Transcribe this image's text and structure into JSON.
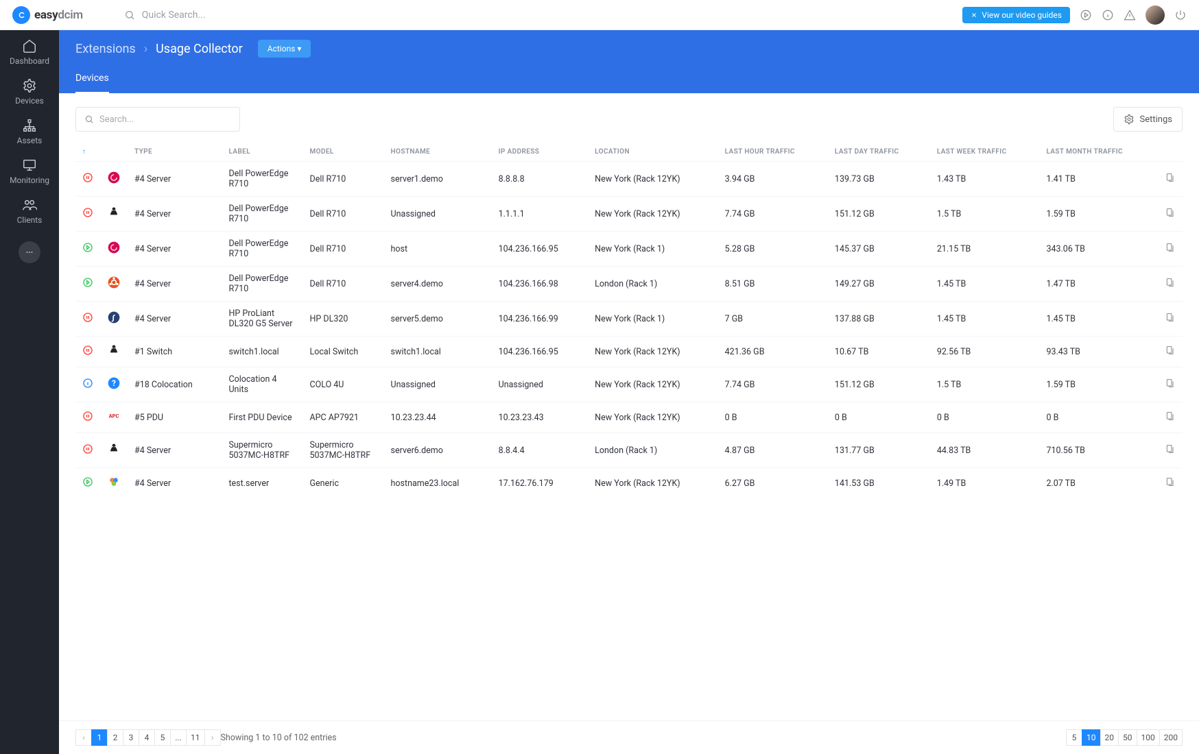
{
  "brand": {
    "name_bold": "easy",
    "name_gray": "dcim"
  },
  "search": {
    "placeholder": "Quick Search..."
  },
  "topbar": {
    "video_label": "View our video guides",
    "icons": [
      "play-circle",
      "info-circle",
      "alert-triangle",
      "power"
    ]
  },
  "sidebar": {
    "items": [
      {
        "label": "Dashboard",
        "icon": "home"
      },
      {
        "label": "Devices",
        "icon": "gear"
      },
      {
        "label": "Assets",
        "icon": "nodes"
      },
      {
        "label": "Monitoring",
        "icon": "monitor"
      },
      {
        "label": "Clients",
        "icon": "users"
      }
    ]
  },
  "breadcrumb": {
    "root": "Extensions",
    "leaf": "Usage Collector",
    "actions_label": "Actions"
  },
  "tabs": [
    {
      "label": "Devices",
      "active": true
    }
  ],
  "toolbar": {
    "search_placeholder": "Search...",
    "settings_label": "Settings"
  },
  "columns": [
    "",
    "",
    "TYPE",
    "LABEL",
    "MODEL",
    "HOSTNAME",
    "IP ADDRESS",
    "LOCATION",
    "LAST HOUR TRAFFIC",
    "LAST DAY TRAFFIC",
    "LAST WEEK TRAFFIC",
    "LAST MONTH TRAFFIC",
    ""
  ],
  "rows": [
    {
      "status": "stop",
      "os": "debian",
      "type": "#4 Server",
      "label": "Dell PowerEdge R710",
      "model": "Dell R710",
      "hostname": "server1.demo",
      "ip": "8.8.8.8",
      "location": "New York (Rack 12YK)",
      "hour": "3.94 GB",
      "day": "139.73 GB",
      "week": "1.43 TB",
      "month": "1.41 TB"
    },
    {
      "status": "stop",
      "os": "linux",
      "type": "#4 Server",
      "label": "Dell PowerEdge R710",
      "model": "Dell R710",
      "hostname": "Unassigned",
      "ip": "1.1.1.1",
      "location": "New York (Rack 12YK)",
      "hour": "7.74 GB",
      "day": "151.12 GB",
      "week": "1.5 TB",
      "month": "1.59 TB"
    },
    {
      "status": "run",
      "os": "debian",
      "type": "#4 Server",
      "label": "Dell PowerEdge R710",
      "model": "Dell R710",
      "hostname": "host",
      "ip": "104.236.166.95",
      "location": "New York (Rack 1)",
      "hour": "5.28 GB",
      "day": "145.37 GB",
      "week": "21.15 TB",
      "month": "343.06 TB"
    },
    {
      "status": "run",
      "os": "ubuntu",
      "type": "#4 Server",
      "label": "Dell PowerEdge R710",
      "model": "Dell R710",
      "hostname": "server4.demo",
      "ip": "104.236.166.98",
      "location": "London (Rack 1)",
      "hour": "8.51 GB",
      "day": "149.27 GB",
      "week": "1.45 TB",
      "month": "1.47 TB"
    },
    {
      "status": "stop",
      "os": "fedora",
      "type": "#4 Server",
      "label": "HP ProLiant DL320 G5 Server",
      "model": "HP DL320",
      "hostname": "server5.demo",
      "ip": "104.236.166.99",
      "location": "New York (Rack 1)",
      "hour": "7 GB",
      "day": "137.88 GB",
      "week": "1.45 TB",
      "month": "1.45 TB"
    },
    {
      "status": "stop",
      "os": "linux",
      "type": "#1 Switch",
      "label": "switch1.local",
      "model": "Local Switch",
      "hostname": "switch1.local",
      "ip": "104.236.166.95",
      "location": "New York (Rack 12YK)",
      "hour": "421.36 GB",
      "day": "10.67 TB",
      "week": "92.56 TB",
      "month": "93.43 TB"
    },
    {
      "status": "info",
      "os": "unknown",
      "type": "#18 Colocation",
      "label": "Colocation 4 Units",
      "model": "COLO 4U",
      "hostname": "Unassigned",
      "ip": "Unassigned",
      "location": "New York (Rack 12YK)",
      "hour": "7.74 GB",
      "day": "151.12 GB",
      "week": "1.5 TB",
      "month": "1.59 TB"
    },
    {
      "status": "stop",
      "os": "apc",
      "type": "#5 PDU",
      "label": "First PDU Device",
      "model": "APC AP7921",
      "hostname": "10.23.23.44",
      "ip": "10.23.23.43",
      "location": "New York (Rack 12YK)",
      "hour": "0 B",
      "day": "0 B",
      "week": "0 B",
      "month": "0 B"
    },
    {
      "status": "stop",
      "os": "linux",
      "type": "#4 Server",
      "label": "Supermicro 5037MC-H8TRF",
      "model": "Supermicro 5037MC-H8TRF",
      "hostname": "server6.demo",
      "ip": "8.8.4.4",
      "location": "London (Rack 1)",
      "hour": "4.87 GB",
      "day": "131.77 GB",
      "week": "44.83 TB",
      "month": "710.56 TB"
    },
    {
      "status": "run",
      "os": "generic",
      "type": "#4 Server",
      "label": "test.server",
      "model": "Generic",
      "hostname": "hostname23.local",
      "ip": "17.162.76.179",
      "location": "New York (Rack 12YK)",
      "hour": "6.27 GB",
      "day": "141.53 GB",
      "week": "1.49 TB",
      "month": "2.07 TB"
    }
  ],
  "footer": {
    "entries_text": "Showing 1 to 10 of 102 entries",
    "pages": [
      "1",
      "2",
      "3",
      "4",
      "5",
      "...",
      "11"
    ],
    "active_page": "1",
    "page_sizes": [
      "5",
      "10",
      "20",
      "50",
      "100",
      "200"
    ],
    "active_size": "10"
  }
}
